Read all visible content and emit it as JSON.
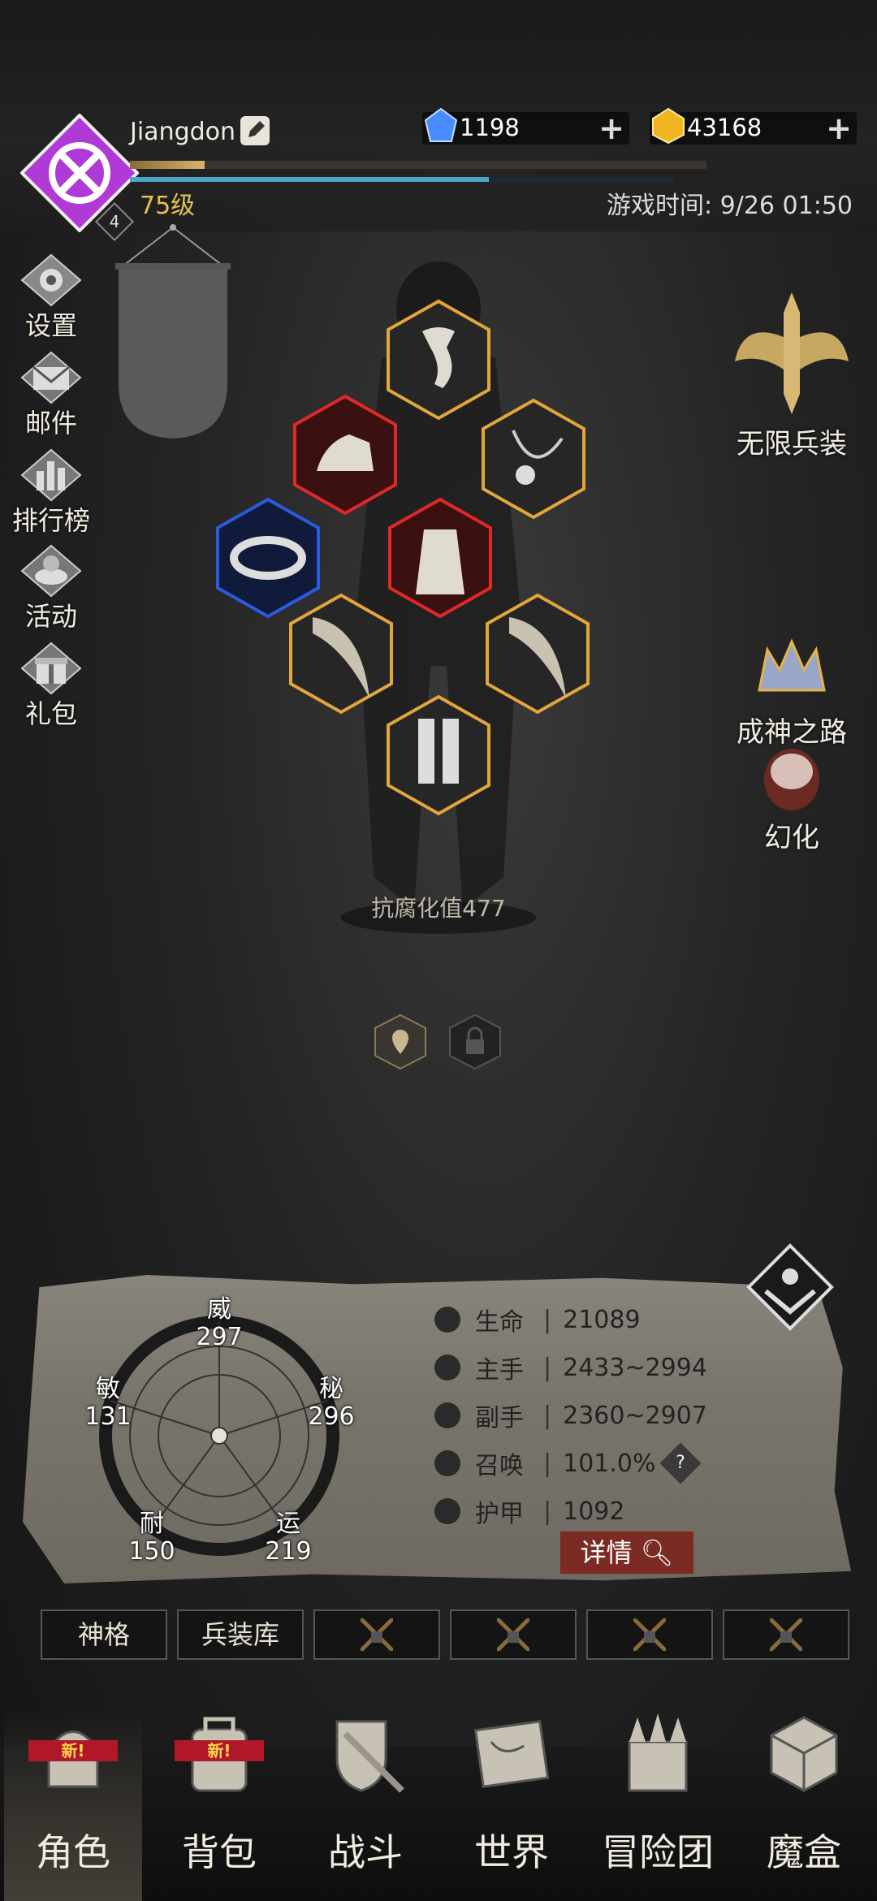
{
  "header": {
    "username": "Jiangdon",
    "badge_number": "4",
    "level_label": "75级",
    "game_time": "游戏时间: 9/26 01:50",
    "xp_progress": 0.13,
    "hp_progress": 0.66
  },
  "currencies": [
    {
      "name": "blue-gem",
      "value": "1198",
      "color": "#4a8cff"
    },
    {
      "name": "gold-gem",
      "value": "43168",
      "color": "#f0b520"
    }
  ],
  "side_menu": [
    {
      "id": "settings",
      "label": "设置",
      "icon": "gear-icon"
    },
    {
      "id": "mail",
      "label": "邮件",
      "icon": "envelope-icon"
    },
    {
      "id": "ranking",
      "label": "排行榜",
      "icon": "bar-chart-icon"
    },
    {
      "id": "events",
      "label": "活动",
      "icon": "chest-icon"
    },
    {
      "id": "gifts",
      "label": "礼包",
      "icon": "gift-icon"
    }
  ],
  "right_menu": [
    {
      "id": "infinite-gear",
      "label": "无限兵装",
      "icon": "winged-sword-icon"
    },
    {
      "id": "godhood",
      "label": "成神之路",
      "icon": "crown-icon"
    },
    {
      "id": "transform",
      "label": "幻化",
      "icon": "mask-icon"
    }
  ],
  "equipment": {
    "slots": [
      {
        "id": "head",
        "icon": "scarf-icon",
        "rarity": "gold"
      },
      {
        "id": "hand",
        "icon": "gauntlet-icon",
        "rarity": "red"
      },
      {
        "id": "neck",
        "icon": "necklace-icon",
        "rarity": "gold"
      },
      {
        "id": "ring",
        "icon": "bracelet-icon",
        "rarity": "blue"
      },
      {
        "id": "body",
        "icon": "robe-icon",
        "rarity": "red"
      },
      {
        "id": "main-hand",
        "icon": "horn-blade-icon",
        "rarity": "gold"
      },
      {
        "id": "off-hand",
        "icon": "horn-blade-icon",
        "rarity": "gold"
      },
      {
        "id": "legs",
        "icon": "boots-icon",
        "rarity": "gold"
      }
    ],
    "resist_label": "抗腐化值477"
  },
  "attributes": {
    "wei": {
      "label": "威",
      "value": "297"
    },
    "mi": {
      "label": "秘",
      "value": "296"
    },
    "yun": {
      "label": "运",
      "value": "219"
    },
    "nai": {
      "label": "耐",
      "value": "150"
    },
    "min": {
      "label": "敏",
      "value": "131"
    }
  },
  "stats": [
    {
      "label": "生命",
      "value": "21089",
      "icon": "heart-icon"
    },
    {
      "label": "主手",
      "value": "2433~2994",
      "icon": "sword-icon"
    },
    {
      "label": "副手",
      "value": "2360~2907",
      "icon": "dagger-icon"
    },
    {
      "label": "召唤",
      "value": "101.0%",
      "icon": "summon-icon"
    },
    {
      "label": "护甲",
      "value": "1092",
      "icon": "armor-icon"
    }
  ],
  "details_button": "详情",
  "tabs": [
    {
      "label": "神格",
      "locked": false
    },
    {
      "label": "兵装库",
      "locked": false
    },
    {
      "label": "",
      "locked": true
    },
    {
      "label": "",
      "locked": true
    },
    {
      "label": "",
      "locked": true
    },
    {
      "label": "",
      "locked": true
    }
  ],
  "nav": [
    {
      "label": "角色",
      "icon": "helmet-icon",
      "badge": "新!",
      "active": true
    },
    {
      "label": "背包",
      "icon": "backpack-icon",
      "badge": "新!",
      "active": false
    },
    {
      "label": "战斗",
      "icon": "shield-sword-icon",
      "badge": "",
      "active": false
    },
    {
      "label": "世界",
      "icon": "map-scroll-icon",
      "badge": "",
      "active": false
    },
    {
      "label": "冒险团",
      "icon": "castle-icon",
      "badge": "",
      "active": false
    },
    {
      "label": "魔盒",
      "icon": "cube-icon",
      "badge": "",
      "active": false
    }
  ]
}
